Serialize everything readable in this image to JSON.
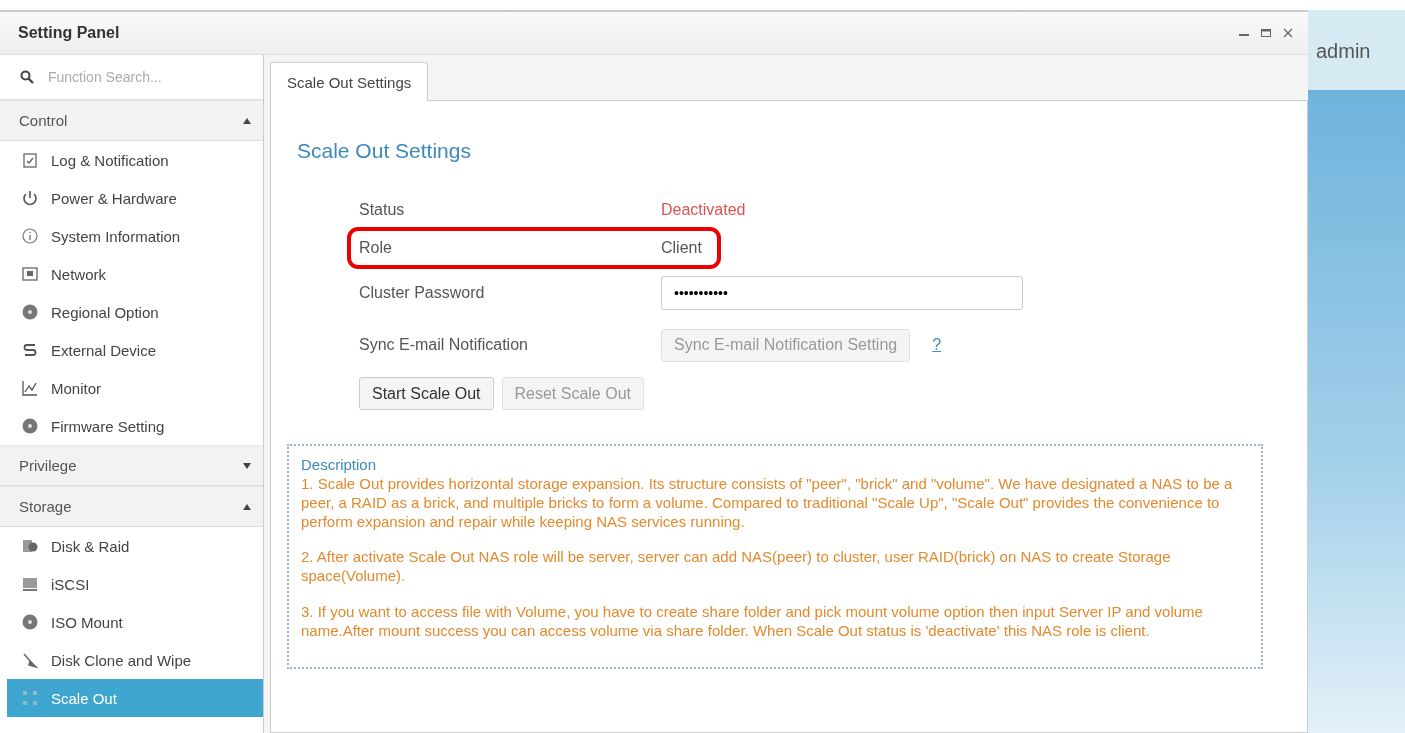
{
  "window": {
    "title": "Setting Panel"
  },
  "user": {
    "name": "admin"
  },
  "search": {
    "placeholder": "Function Search..."
  },
  "sidebar": {
    "sections": [
      {
        "label": "Control",
        "expanded": true,
        "items": [
          {
            "label": "Log & Notification",
            "selected": false
          },
          {
            "label": "Power & Hardware",
            "selected": false
          },
          {
            "label": "System Information",
            "selected": false
          },
          {
            "label": "Network",
            "selected": false
          },
          {
            "label": "Regional Option",
            "selected": false
          },
          {
            "label": "External Device",
            "selected": false
          },
          {
            "label": "Monitor",
            "selected": false
          },
          {
            "label": "Firmware Setting",
            "selected": false
          }
        ]
      },
      {
        "label": "Privilege",
        "expanded": false
      },
      {
        "label": "Storage",
        "expanded": true,
        "items": [
          {
            "label": "Disk & Raid",
            "selected": false
          },
          {
            "label": "iSCSI",
            "selected": false
          },
          {
            "label": "ISO Mount",
            "selected": false
          },
          {
            "label": "Disk Clone and Wipe",
            "selected": false
          },
          {
            "label": "Scale Out",
            "selected": true
          }
        ]
      }
    ]
  },
  "tabs": [
    {
      "label": "Scale Out Settings",
      "selected": true
    }
  ],
  "content": {
    "heading": "Scale Out Settings",
    "rows": [
      {
        "kind": "text",
        "label": "Status",
        "value": "Deactivated",
        "color": "#d9534f",
        "highlighted": false
      },
      {
        "kind": "text",
        "label": "Role",
        "value": "Client",
        "color": "#555555",
        "highlighted": true
      },
      {
        "kind": "password",
        "label": "Cluster Password",
        "value": "•••••••••••",
        "highlighted": false
      },
      {
        "kind": "button",
        "label": "Sync E-mail Notification",
        "button": "Sync E-mail Notification Setting",
        "disabled": true,
        "help": "?",
        "highlighted": false
      }
    ],
    "buttons": [
      {
        "label": "Start Scale Out",
        "disabled": false
      },
      {
        "label": "Reset Scale Out",
        "disabled": true
      }
    ],
    "description": {
      "title": "Description",
      "paragraphs": [
        "1. Scale Out provides horizontal storage expansion. Its structure consists of \"peer\", \"brick\" and \"volume\". We have designated a NAS to be a peer, a RAID as a brick, and multiple bricks to form a volume. Compared to traditional \"Scale Up\", \"Scale Out\" provides the convenience to perform expansion and repair while keeping NAS services running.",
        "2. After activate Scale Out NAS role will be server, server can add NAS(peer) to cluster, user RAID(brick) on NAS to create Storage space(Volume).",
        "3. If you want to access file with Volume, you have to create share folder and pick mount volume option then input Server IP and volume name.After mount success you can access volume via share folder. When Scale Out status is 'deactivate' this NAS role is client."
      ]
    }
  }
}
